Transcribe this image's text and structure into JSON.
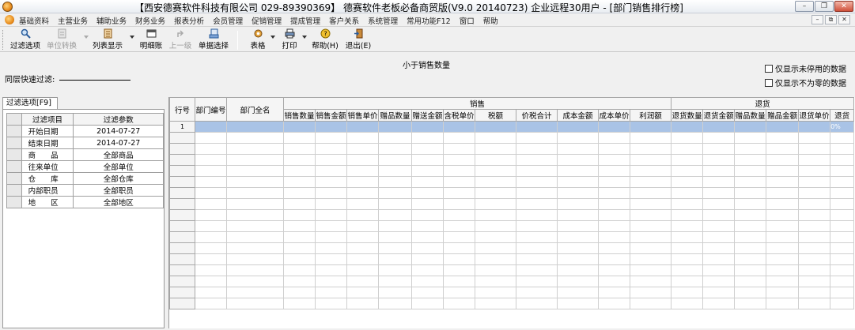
{
  "window": {
    "title": "【西安德赛软件科技有限公司 029-89390369】 德赛软件老板必备商贸版(V9.0 20140723) 企业远程30用户 - [部门销售排行榜]",
    "buttons": {
      "minimize": "–",
      "maximize": "❐",
      "close": "✕"
    }
  },
  "menu": {
    "items": [
      "基础资料",
      "主营业务",
      "辅助业务",
      "财务业务",
      "报表分析",
      "会员管理",
      "促销管理",
      "提成管理",
      "客户关系",
      "系统管理",
      "常用功能F12",
      "窗口",
      "帮助"
    ],
    "mdi": {
      "minimize": "–",
      "restore": "⧉",
      "close": "✕"
    }
  },
  "toolbar": {
    "filter": "过滤选项",
    "convert": "单位转换",
    "list_display": "列表显示",
    "detail": "明细账",
    "up_level": "上一级",
    "doc_select": "单据选择",
    "table": "表格",
    "print": "打印",
    "help": "帮助(H)",
    "exit": "退出(E)"
  },
  "header": {
    "center_title": "小于销售数量",
    "quick_filter_label": "同层快速过滤:",
    "show_unused": "仅显示未停用的数据",
    "show_nonzero": "仅显示不为零的数据"
  },
  "filter_panel": {
    "tab_label": "过滤选项[F9]",
    "col_item": "过滤项目",
    "col_param": "过滤参数",
    "rows": [
      {
        "item": "开始日期",
        "value": "2014-07-27"
      },
      {
        "item": "结束日期",
        "value": "2014-07-27"
      },
      {
        "item": "商　　品",
        "value": "全部商品"
      },
      {
        "item": "往来单位",
        "value": "全部单位"
      },
      {
        "item": "仓　　库",
        "value": "全部仓库"
      },
      {
        "item": "内部职员",
        "value": "全部职员"
      },
      {
        "item": "地　　区",
        "value": "全部地区"
      }
    ]
  },
  "grid": {
    "col_row_no": "行号",
    "col_dept_code": "部门编号",
    "col_dept_name": "部门全名",
    "group_sales": "销售",
    "group_returns": "退货",
    "sales_cols": [
      "销售数量",
      "销售金额",
      "销售单价",
      "赠品数量",
      "赠送金额",
      "含税单价",
      "税额",
      "价税合计",
      "成本金额",
      "成本单价",
      "利润额"
    ],
    "return_cols": [
      "退货数量",
      "退货金额",
      "赠品数量",
      "赠品金额",
      "退货单价",
      "退货"
    ],
    "first_row_no": "1",
    "first_row_pct": "0%"
  }
}
